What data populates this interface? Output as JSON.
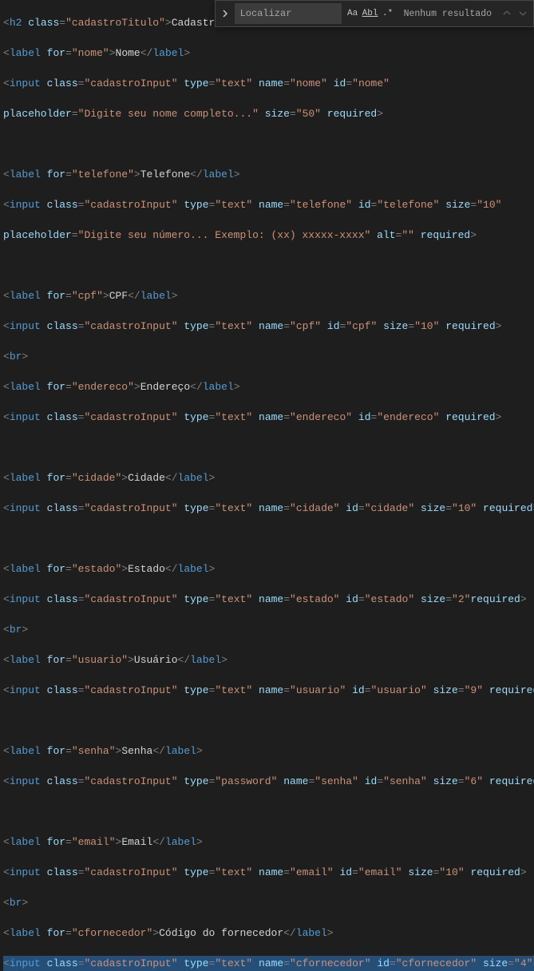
{
  "findbar": {
    "placeholder": "Localizar",
    "result_text": "Nenhum resultado",
    "opt_case": "Aa",
    "opt_word": "Abl",
    "opt_regex": ".*"
  },
  "code": {
    "h2": {
      "tag": "h2",
      "class": "cadastroTitulo",
      "text": "Cadastro De F"
    },
    "nome_label": {
      "for": "nome",
      "text": "Nome"
    },
    "nome_input": {
      "class": "cadastroInput",
      "type": "text",
      "name": "nome",
      "id": "nome"
    },
    "nome_extra": {
      "placeholder": "Digite seu nome completo...",
      "size": "50",
      "required": "required"
    },
    "tel_label": {
      "for": "telefone",
      "text": "Telefone"
    },
    "tel_input": {
      "class": "cadastroInput",
      "type": "text",
      "name": "telefone",
      "id": "telefone",
      "size": "10"
    },
    "tel_extra": {
      "placeholder": "Digite seu número... Exemplo: (xx) xxxxx-xxxx",
      "alt": "",
      "required": "required"
    },
    "cpf_label": {
      "for": "cpf",
      "text": "CPF"
    },
    "cpf_input": {
      "class": "cadastroInput",
      "type": "text",
      "name": "cpf",
      "id": "cpf",
      "size": "10",
      "required": "required"
    },
    "end_label": {
      "for": "endereco",
      "text": "Endereço"
    },
    "end_input": {
      "class": "cadastroInput",
      "type": "text",
      "name": "endereco",
      "id": "endereco",
      "required": "required"
    },
    "cid_label": {
      "for": "cidade",
      "text": "Cidade"
    },
    "cid_input": {
      "class": "cadastroInput",
      "type": "text",
      "name": "cidade",
      "id": "cidade",
      "size": "10",
      "required": "required"
    },
    "est_label": {
      "for": "estado",
      "text": "Estado"
    },
    "est_input": {
      "class": "cadastroInput",
      "type": "text",
      "name": "estado",
      "id": "estado",
      "size": "2",
      "required": "required"
    },
    "usr_label": {
      "for": "usuario",
      "text": "Usuário"
    },
    "usr_input": {
      "class": "cadastroInput",
      "type": "text",
      "name": "usuario",
      "id": "usuario",
      "size": "9",
      "required": "required"
    },
    "sen_label": {
      "for": "senha",
      "text": "Senha"
    },
    "sen_input": {
      "class": "cadastroInput",
      "type": "password",
      "name": "senha",
      "id": "senha",
      "size": "6",
      "required": "required"
    },
    "eml_label": {
      "for": "email",
      "text": "Email"
    },
    "eml_input": {
      "class": "cadastroInput",
      "type": "text",
      "name": "email",
      "id": "email",
      "size": "10",
      "required": "required"
    },
    "cfo_label": {
      "for": "cfornecedor",
      "text": "Código do fornecedor"
    },
    "cfo_input": {
      "class": "cadastroInput",
      "type": "text",
      "name": "cfornecedor",
      "id": "cfornecedor",
      "size": "4"
    },
    "br": "br",
    "label": "label",
    "input": "input"
  }
}
